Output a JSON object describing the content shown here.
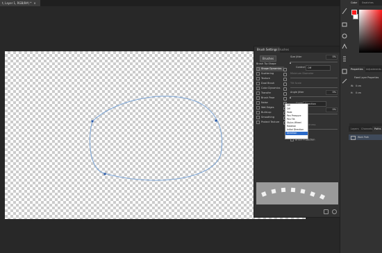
{
  "document_tab": {
    "title": "t, Layer 1, RGB/8#) *",
    "close": "×"
  },
  "brush_panel": {
    "tabs": [
      "Brush Settings",
      "Brushes"
    ],
    "brushes_button": "Brushes",
    "categories": [
      {
        "label": "Brush Tip Shape",
        "selected": false,
        "checked": false
      },
      {
        "label": "Shape Dynamics",
        "selected": true,
        "checked": true
      },
      {
        "label": "Scattering",
        "selected": false,
        "checked": false
      },
      {
        "label": "Texture",
        "selected": false,
        "checked": false
      },
      {
        "label": "Dual Brush",
        "selected": false,
        "checked": false
      },
      {
        "label": "Color Dynamics",
        "selected": false,
        "checked": false
      },
      {
        "label": "Transfer",
        "selected": false,
        "checked": false
      },
      {
        "label": "Brush Pose",
        "selected": false,
        "checked": false
      },
      {
        "label": "Noise",
        "selected": false,
        "checked": false
      },
      {
        "label": "Wet Edges",
        "selected": false,
        "checked": false
      },
      {
        "label": "Build-up",
        "selected": false,
        "checked": false
      },
      {
        "label": "Smoothing",
        "selected": false,
        "checked": true
      },
      {
        "label": "Protect Texture",
        "selected": false,
        "checked": false
      }
    ],
    "size_jitter": {
      "label": "Size Jitter",
      "value": "0%"
    },
    "control1": {
      "label": "Control:",
      "value": "Off"
    },
    "min_diameter": "Minimum Diameter",
    "tilt_scale": "Tilt Scale",
    "angle_jitter": {
      "label": "Angle Jitter",
      "value": "0%"
    },
    "control2": {
      "label": "Control:",
      "value": "Direction"
    },
    "roundness_label": "Roundness",
    "roundness_value": "0%",
    "control3_label": "Control:",
    "min_roundness": "Minimum Roundness",
    "flip_x": "Flip X Jitter",
    "brush_projection": "Brush Projection",
    "dropdown_options": [
      "Off",
      "Fade",
      "Pen Pressure",
      "Pen Tilt",
      "Stylus Wheel",
      "Rotation",
      "Initial Direction",
      "Direction"
    ],
    "dropdown_header": "Off"
  },
  "color_panel": {
    "tabs": [
      "Color",
      "Swatches"
    ],
    "fg_color": "#ff1a1a",
    "bg_color": "#ffffff"
  },
  "properties_panel": {
    "tabs": [
      "Properties",
      "Adjustments"
    ],
    "title": "Fixed Layer Properties",
    "w_label": "W:",
    "w_value": "0 cm",
    "h_label": "H:",
    "h_value": "0 cm"
  },
  "layers_panel": {
    "tabs": [
      "Layers",
      "Channels",
      "Paths"
    ],
    "items": [
      {
        "label": "Work Path"
      }
    ]
  }
}
